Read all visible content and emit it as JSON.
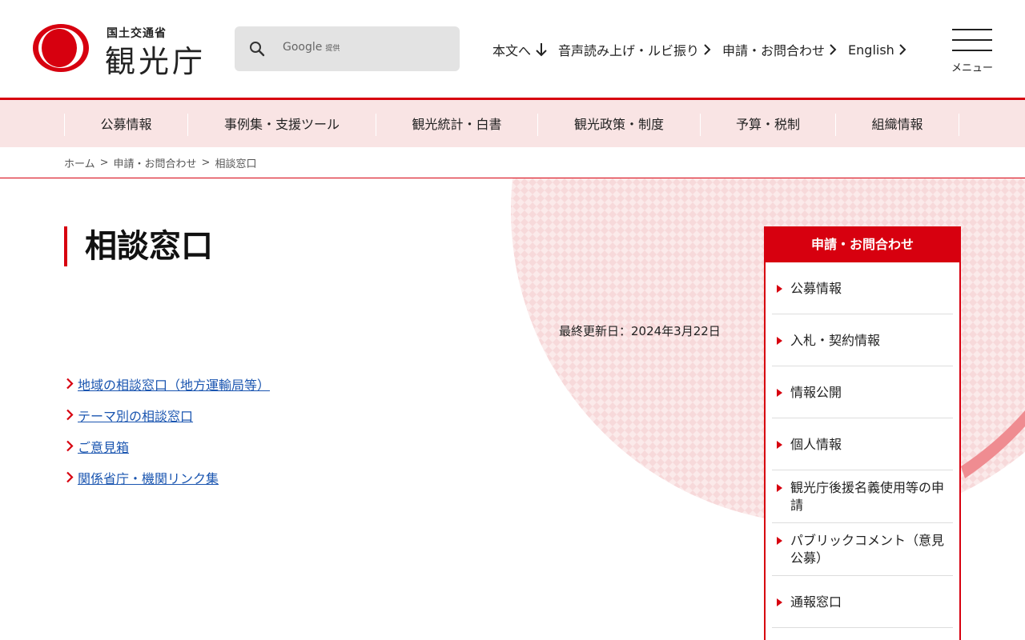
{
  "header": {
    "org_sub": "国土交通省",
    "org_main": "観光庁",
    "search": {
      "label": "Google",
      "provider": "提供"
    },
    "links": [
      {
        "label": "本文へ",
        "icon": "arrow-down-icon"
      },
      {
        "label": "音声読み上げ・ルビ振り",
        "icon": "chevron-right-icon"
      },
      {
        "label": "申請・お問合わせ",
        "icon": "chevron-right-icon"
      },
      {
        "label": "English",
        "icon": "chevron-right-icon"
      }
    ],
    "menu_label": "メニュー"
  },
  "gnav": {
    "items": [
      "公募情報",
      "事例集・支援ツール",
      "観光統計・白書",
      "観光政策・制度",
      "予算・税制",
      "組織情報"
    ]
  },
  "breadcrumb": {
    "items": [
      "ホーム",
      "申請・お問合わせ",
      "相談窓口"
    ],
    "separator": ">"
  },
  "main": {
    "title": "相談窓口",
    "updated": "最終更新日：2024年3月22日",
    "links": [
      "地域の相談窓口（地方運輸局等）",
      "テーマ別の相談窓口",
      "ご意見箱",
      "関係省庁・機関リンク集"
    ]
  },
  "sidebar": {
    "heading": "申請・お問合わせ",
    "items": [
      {
        "lines": [
          "公募情報"
        ]
      },
      {
        "lines": [
          "入札・契約情報"
        ]
      },
      {
        "lines": [
          "情報公開"
        ]
      },
      {
        "lines": [
          "個人情報"
        ]
      },
      {
        "lines": [
          "観光庁後援名義使用等の申",
          "請"
        ]
      },
      {
        "lines": [
          "パブリックコメント（意見",
          "公募）"
        ]
      },
      {
        "lines": [
          "通報窓口"
        ]
      }
    ]
  },
  "colors": {
    "accent": "#d7000f",
    "nav_bg": "#f9e4e4",
    "link": "#1a55b0",
    "deco": "#f2b8bb"
  }
}
